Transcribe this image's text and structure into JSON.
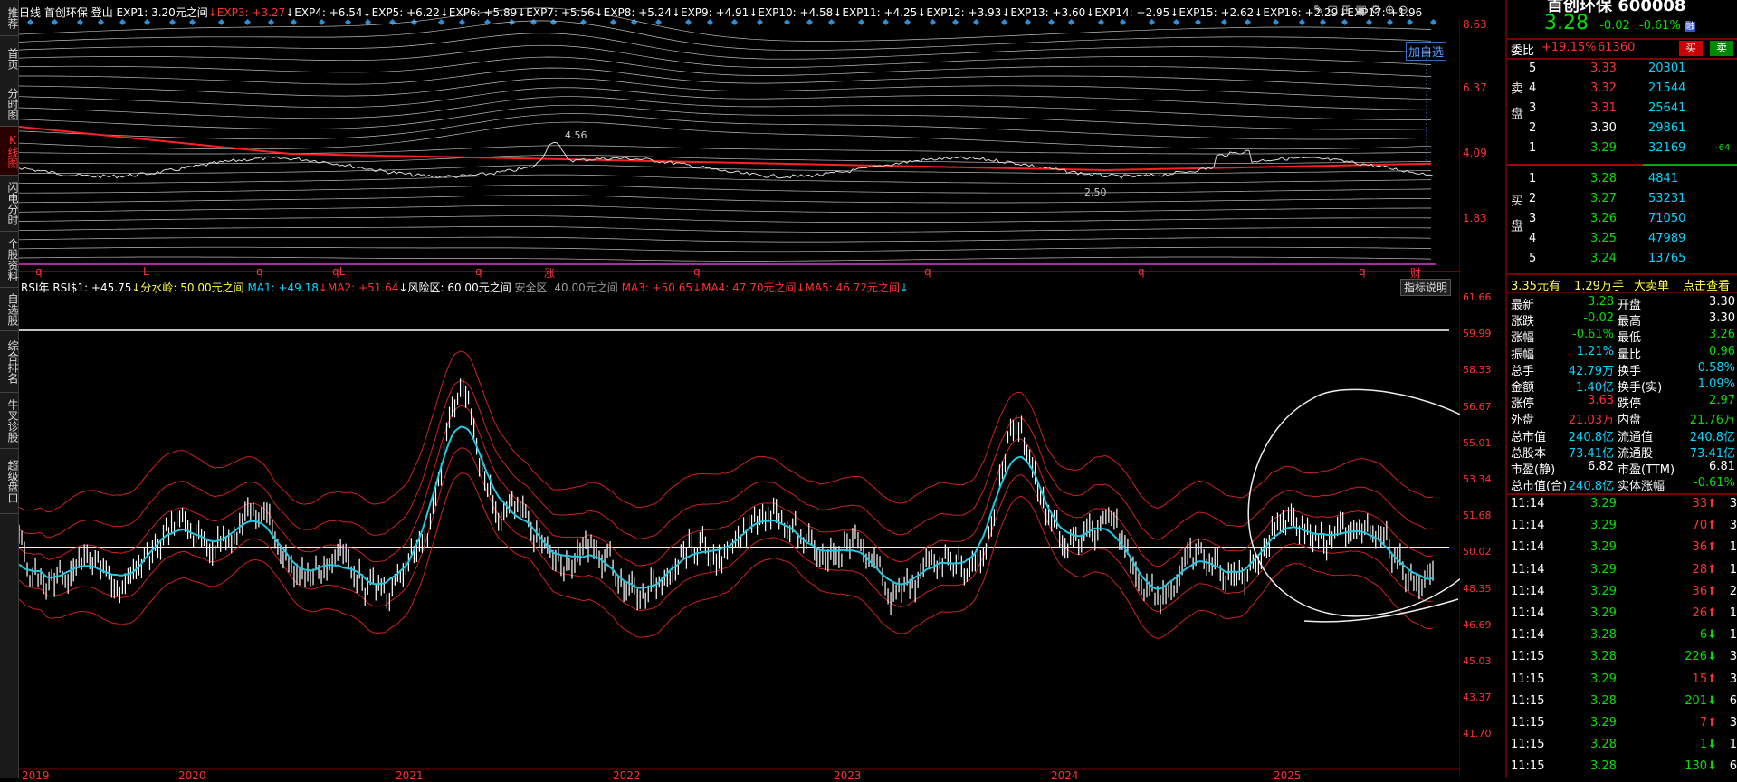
{
  "sidebar": [
    {
      "label": "推荐",
      "active": false
    },
    {
      "label": "首页",
      "active": false
    },
    {
      "label": "分时图",
      "active": false
    },
    {
      "label": "K线图",
      "active": true
    },
    {
      "label": "闪电分时",
      "active": false
    },
    {
      "label": "个股资料",
      "active": false
    },
    {
      "label": "自选股",
      "active": false
    },
    {
      "label": "综合排名",
      "active": false
    },
    {
      "label": "牛叉诊股",
      "active": false
    },
    {
      "label": "超级盘口",
      "active": false
    }
  ],
  "header": {
    "period": "日线",
    "name": "首创环保",
    "region": "登山",
    "exp_items": [
      {
        "t": "EXP1: 3.20元之间",
        "c": "white"
      },
      {
        "t": "↓EXP3: +3.27",
        "c": "red"
      },
      {
        "t": "↓EXP4: +6.54",
        "c": "white"
      },
      {
        "t": "↓EXP5: +6.22",
        "c": "white"
      },
      {
        "t": "↓EXP6: +5.89",
        "c": "white"
      },
      {
        "t": "↓EXP7: +5.56",
        "c": "white"
      },
      {
        "t": "↓EXP8: +5.24",
        "c": "white"
      },
      {
        "t": "↓EXP9: +4.91",
        "c": "white"
      },
      {
        "t": "↓EXP10: +4.58",
        "c": "white"
      },
      {
        "t": "↓EXP11: +4.25",
        "c": "white"
      },
      {
        "t": "↓EXP12: +3.93",
        "c": "white"
      },
      {
        "t": "↓EXP13: +3.60",
        "c": "white"
      },
      {
        "t": "↓EXP14: +2.95",
        "c": "white"
      },
      {
        "t": "↓EXP15: +2.62",
        "c": "white"
      },
      {
        "t": "↓EXP16: +2.29",
        "c": "white"
      },
      {
        "t": "↓EXP17: +1.96",
        "c": "white"
      }
    ],
    "add_watch": "加自选"
  },
  "price_axis": [
    "8.63",
    "6.37",
    "4.09",
    "1.83"
  ],
  "price_annotations": {
    "high": "4.56",
    "low": "2.50"
  },
  "event_markers": [
    "q",
    "L",
    "q",
    "qL",
    "q",
    "涨",
    "q",
    "q",
    "q",
    "q",
    "财"
  ],
  "rsi_header": [
    {
      "t": "RSI年 ",
      "c": "white"
    },
    {
      "t": "RSI$1: +45.75",
      "c": "white"
    },
    {
      "t": "↓分水岭: 50.00元之间",
      "c": "yellow"
    },
    {
      "t": " MA1: +49.18",
      "c": "cyan"
    },
    {
      "t": "↓MA2: +51.64",
      "c": "red"
    },
    {
      "t": "↓风险区: 60.00元之间",
      "c": "white"
    },
    {
      "t": " 安全区: 40.00元之间",
      "c": "gray"
    },
    {
      "t": " MA3: +50.65",
      "c": "red"
    },
    {
      "t": "↓MA4: 47.70元之间",
      "c": "red"
    },
    {
      "t": "↓MA5: 46.72元之间",
      "c": "red"
    },
    {
      "t": "↓",
      "c": "cyan"
    }
  ],
  "indicator_btn": "指标说明",
  "rsi_axis": [
    "61.66",
    "59.99",
    "58.33",
    "56.67",
    "55.01",
    "53.34",
    "51.68",
    "50.02",
    "48.35",
    "46.69",
    "45.03",
    "43.37",
    "41.70"
  ],
  "years": [
    "2019",
    "2020",
    "2021",
    "2022",
    "2023",
    "2024",
    "2025"
  ],
  "quote": {
    "title": "首创环保 600008",
    "price": "3.28",
    "change": "-0.02",
    "pct": "-0.61%",
    "badge": "融",
    "weibi_label": "委比",
    "weibi": "+19.15%",
    "weicha": "61360",
    "buy_btn": "买",
    "sell_btn": "卖"
  },
  "asks": [
    {
      "lvl": "5",
      "price": "3.33",
      "vol": "20301",
      "chg": "",
      "pc": "red"
    },
    {
      "lvl": "4",
      "price": "3.32",
      "vol": "21544",
      "chg": "",
      "pc": "red"
    },
    {
      "lvl": "3",
      "price": "3.31",
      "vol": "25641",
      "chg": "",
      "pc": "red"
    },
    {
      "lvl": "2",
      "price": "3.30",
      "vol": "29861",
      "chg": "",
      "pc": "white"
    },
    {
      "lvl": "1",
      "price": "3.29",
      "vol": "32169",
      "chg": "-64",
      "pc": "green"
    }
  ],
  "ask_label": "卖盘",
  "bids": [
    {
      "lvl": "1",
      "price": "3.28",
      "vol": "4841",
      "pc": "green"
    },
    {
      "lvl": "2",
      "price": "3.27",
      "vol": "53231",
      "pc": "green"
    },
    {
      "lvl": "3",
      "price": "3.26",
      "vol": "71050",
      "pc": "green"
    },
    {
      "lvl": "4",
      "price": "3.25",
      "vol": "47989",
      "pc": "green"
    },
    {
      "lvl": "5",
      "price": "3.24",
      "vol": "13765",
      "pc": "green"
    }
  ],
  "bid_label": "买盘",
  "big_order": {
    "price": "3.35元有",
    "vol": "1.29万手",
    "label": "大卖单",
    "link": "点击查看"
  },
  "stats": [
    {
      "l1": "最新",
      "v1": "3.28",
      "c1": "green",
      "l2": "开盘",
      "v2": "3.30",
      "c2": "white"
    },
    {
      "l1": "涨跌",
      "v1": "-0.02",
      "c1": "green",
      "l2": "最高",
      "v2": "3.30",
      "c2": "white"
    },
    {
      "l1": "涨幅",
      "v1": "-0.61%",
      "c1": "green",
      "l2": "最低",
      "v2": "3.26",
      "c2": "green"
    },
    {
      "l1": "振幅",
      "v1": "1.21%",
      "c1": "cyan",
      "l2": "量比",
      "v2": "0.96",
      "c2": "green"
    },
    {
      "l1": "总手",
      "v1": "42.79万",
      "c1": "cyan",
      "l2": "换手",
      "v2": "0.58%",
      "c2": "cyan"
    },
    {
      "l1": "金额",
      "v1": "1.40亿",
      "c1": "cyan",
      "l2": "换手(实)",
      "v2": "1.09%",
      "c2": "cyan"
    },
    {
      "l1": "涨停",
      "v1": "3.63",
      "c1": "red",
      "l2": "跌停",
      "v2": "2.97",
      "c2": "green"
    },
    {
      "l1": "外盘",
      "v1": "21.03万",
      "c1": "red",
      "l2": "内盘",
      "v2": "21.76万",
      "c2": "green"
    },
    {
      "l1": "总市值",
      "v1": "240.8亿",
      "c1": "cyan",
      "l2": "流通值",
      "v2": "240.8亿",
      "c2": "cyan"
    },
    {
      "l1": "总股本",
      "v1": "73.41亿",
      "c1": "cyan",
      "l2": "流通股",
      "v2": "73.41亿",
      "c2": "cyan"
    },
    {
      "l1": "市盈(静)",
      "v1": "6.82",
      "c1": "white",
      "l2": "市盈(TTM)",
      "v2": "6.81",
      "c2": "white"
    },
    {
      "l1": "总市值(合)",
      "v1": "240.8亿",
      "c1": "cyan",
      "l2": "实体涨幅",
      "v2": "-0.61%",
      "c2": "green"
    }
  ],
  "ticks": [
    {
      "t": "11:14",
      "p": "3.29",
      "pc": "green",
      "v": "33",
      "dir": "up",
      "n": "3"
    },
    {
      "t": "11:14",
      "p": "3.29",
      "pc": "green",
      "v": "70",
      "dir": "up",
      "n": "3"
    },
    {
      "t": "11:14",
      "p": "3.29",
      "pc": "green",
      "v": "36",
      "dir": "up",
      "n": "1"
    },
    {
      "t": "11:14",
      "p": "3.29",
      "pc": "green",
      "v": "28",
      "dir": "up",
      "n": "1"
    },
    {
      "t": "11:14",
      "p": "3.29",
      "pc": "green",
      "v": "36",
      "dir": "up",
      "n": "2"
    },
    {
      "t": "11:14",
      "p": "3.29",
      "pc": "green",
      "v": "26",
      "dir": "up",
      "n": "1"
    },
    {
      "t": "11:14",
      "p": "3.28",
      "pc": "green",
      "v": "6",
      "dir": "dn",
      "n": "1"
    },
    {
      "t": "11:15",
      "p": "3.28",
      "pc": "green",
      "v": "226",
      "dir": "dn",
      "n": "3"
    },
    {
      "t": "11:15",
      "p": "3.29",
      "pc": "green",
      "v": "15",
      "dir": "up",
      "n": "3"
    },
    {
      "t": "11:15",
      "p": "3.28",
      "pc": "green",
      "v": "201",
      "dir": "dn",
      "n": "6"
    },
    {
      "t": "11:15",
      "p": "3.29",
      "pc": "green",
      "v": "7",
      "dir": "up",
      "n": "3"
    },
    {
      "t": "11:15",
      "p": "3.28",
      "pc": "green",
      "v": "1",
      "dir": "dn",
      "n": "1"
    },
    {
      "t": "11:15",
      "p": "3.28",
      "pc": "green",
      "v": "130",
      "dir": "dn",
      "n": "6"
    }
  ]
}
